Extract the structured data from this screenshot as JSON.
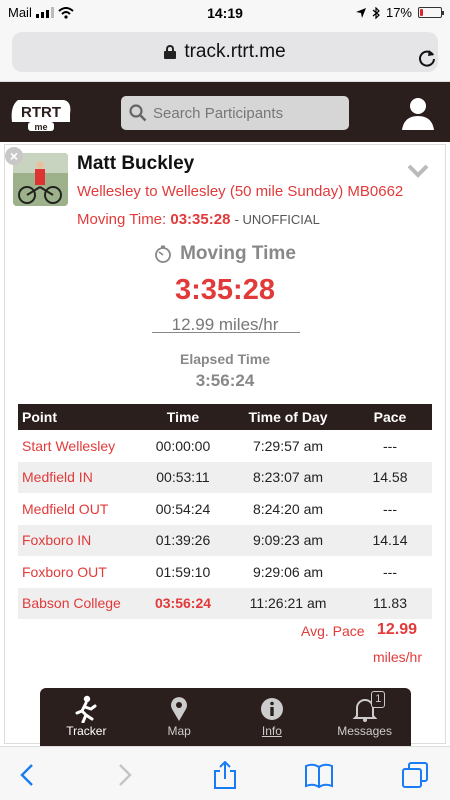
{
  "status_bar": {
    "carrier": "Mail",
    "time": "14:19",
    "battery": "17%",
    "battery_level": 0.17,
    "battery_color": "#e0242f"
  },
  "browser": {
    "url": "track.rtrt.me"
  },
  "app_header": {
    "logo_text": "RTRT",
    "logo_sub": "me",
    "search_placeholder": "Search Participants"
  },
  "participant": {
    "name": "Matt Buckley",
    "event": "Wellesley to Wellesley (50 mile Sunday) MB0662",
    "moving_time_label": "Moving Time:",
    "moving_time_value": "03:35:28",
    "unofficial": "- UNOFFICIAL"
  },
  "summary": {
    "moving_time_title": "Moving Time",
    "moving_time": "3:35:28",
    "rate": "12.99 miles/hr",
    "elapsed_label": "Elapsed Time",
    "elapsed_value": "3:56:24"
  },
  "splits": {
    "headers": [
      "Point",
      "Time",
      "Time of Day",
      "Pace"
    ],
    "rows": [
      {
        "point": "Start Wellesley",
        "time": "00:00:00",
        "tod": "7:29:57 am",
        "pace": "---"
      },
      {
        "point": "Medfield IN",
        "time": "00:53:11",
        "tod": "8:23:07 am",
        "pace": "14.58"
      },
      {
        "point": "Medfield OUT",
        "time": "00:54:24",
        "tod": "8:24:20 am",
        "pace": "---"
      },
      {
        "point": "Foxboro IN",
        "time": "01:39:26",
        "tod": "9:09:23 am",
        "pace": "14.14"
      },
      {
        "point": "Foxboro OUT",
        "time": "01:59:10",
        "tod": "9:29:06 am",
        "pace": "---"
      },
      {
        "point": "Babson College",
        "time": "03:56:24",
        "tod": "11:26:21 am",
        "pace": "11.83"
      }
    ],
    "avg_pace_label": "Avg. Pace",
    "avg_pace_value": "12.99",
    "avg_pace_unit": "miles/hr"
  },
  "tabs": [
    {
      "label": "Tracker",
      "icon": "runner-icon"
    },
    {
      "label": "Map",
      "icon": "map-pin-icon"
    },
    {
      "label": "Info",
      "icon": "info-icon"
    },
    {
      "label": "Messages",
      "icon": "bell-icon",
      "badge": "1"
    }
  ],
  "colors": {
    "accent": "#e23a3a",
    "header_bg": "#2b1f1d"
  }
}
